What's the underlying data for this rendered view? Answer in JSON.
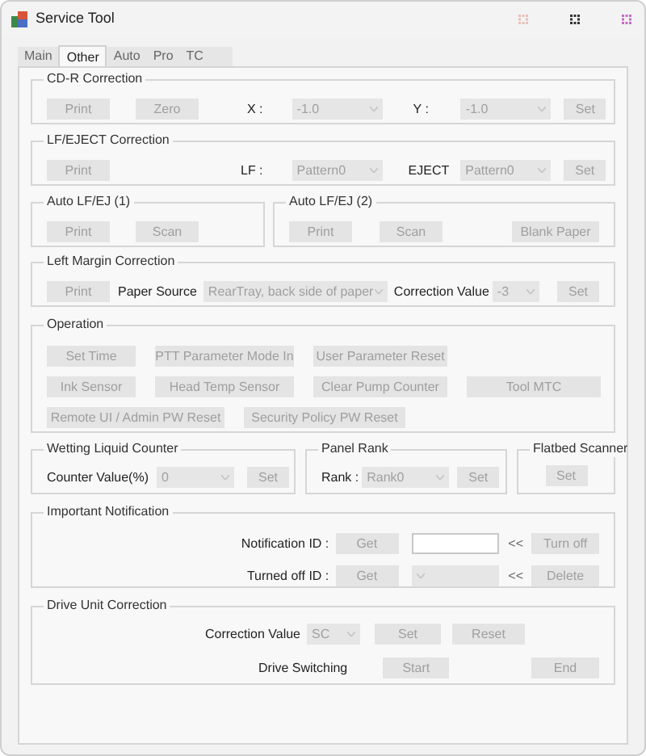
{
  "window": {
    "title": "Service Tool"
  },
  "tabs": [
    {
      "label": "Main",
      "selected": false
    },
    {
      "label": "Other",
      "selected": true
    },
    {
      "label": "Auto",
      "selected": false
    },
    {
      "label": "Pro",
      "selected": false
    },
    {
      "label": "TC",
      "selected": false
    }
  ],
  "cdr": {
    "title": "CD-R Correction",
    "print": {
      "label": "Print",
      "disabled": true
    },
    "zero": {
      "label": "Zero",
      "disabled": true
    },
    "x_label": "X :",
    "x_select": {
      "value": "-1.0",
      "disabled": true
    },
    "y_label": "Y :",
    "y_select": {
      "value": "-1.0",
      "disabled": true
    },
    "set": {
      "label": "Set",
      "disabled": true
    }
  },
  "lf_eject": {
    "title": "LF/EJECT Correction",
    "print": {
      "label": "Print",
      "disabled": true
    },
    "lf_label": "LF :",
    "lf_select": {
      "value": "Pattern0",
      "disabled": true
    },
    "eject_label": "EJECT",
    "eject_select": {
      "value": "Pattern0",
      "disabled": true
    },
    "set": {
      "label": "Set",
      "disabled": true
    }
  },
  "auto_lfej_1": {
    "title": "Auto LF/EJ (1)",
    "print": {
      "label": "Print",
      "disabled": true
    },
    "scan": {
      "label": "Scan",
      "disabled": true
    }
  },
  "auto_lfej_2": {
    "title": "Auto LF/EJ (2)",
    "print": {
      "label": "Print",
      "disabled": true
    },
    "scan": {
      "label": "Scan",
      "disabled": true
    },
    "blank_paper": {
      "label": "Blank Paper",
      "disabled": true
    }
  },
  "left_margin": {
    "title": "Left Margin Correction",
    "print": {
      "label": "Print",
      "disabled": true
    },
    "paper_source_label": "Paper Source",
    "paper_source_select": {
      "value": "RearTray, back side of paper",
      "disabled": true
    },
    "correction_value_label": "Correction Value",
    "correction_value_select": {
      "value": "-3",
      "disabled": true
    },
    "set": {
      "label": "Set",
      "disabled": true
    }
  },
  "operation": {
    "title": "Operation",
    "rows": [
      [
        {
          "label": "Set Time",
          "disabled": true
        },
        {
          "label": "PTT Parameter Mode In",
          "disabled": true
        },
        {
          "label": "User Parameter Reset",
          "disabled": true
        }
      ],
      [
        {
          "label": "Ink Sensor",
          "disabled": true
        },
        {
          "label": "Head Temp Sensor",
          "disabled": true
        },
        {
          "label": "Clear Pump Counter",
          "disabled": true
        },
        {
          "label": "Tool MTC",
          "disabled": true
        }
      ],
      [
        {
          "label": "Remote UI / Admin PW Reset",
          "disabled": true
        },
        {
          "label": "Security Policy PW Reset",
          "disabled": true
        }
      ]
    ]
  },
  "wetting": {
    "title": "Wetting Liquid Counter",
    "counter_label": "Counter Value(%)",
    "counter_select": {
      "value": "0",
      "disabled": true
    },
    "set": {
      "label": "Set",
      "disabled": true
    }
  },
  "panel_rank": {
    "title": "Panel Rank",
    "rank_label": "Rank :",
    "rank_select": {
      "value": "Rank0",
      "disabled": true
    },
    "set": {
      "label": "Set",
      "disabled": true
    }
  },
  "flatbed": {
    "title": "Flatbed Scanner",
    "set": {
      "label": "Set",
      "disabled": true
    }
  },
  "notification": {
    "title": "Important Notification",
    "notification_id_label": "Notification ID :",
    "get": {
      "label": "Get",
      "disabled": true
    },
    "turn_off_marker": "<<",
    "turn_off": {
      "label": "Turn off",
      "disabled": true
    },
    "turned_off_id_label": "Turned off ID :",
    "get_turned_off": {
      "label": "Get",
      "disabled": true
    },
    "turned_off_select": {
      "disabled": true
    },
    "delete_marker": "<<",
    "delete": {
      "label": "Delete",
      "disabled": true
    }
  },
  "drive_unit": {
    "title": "Drive Unit Correction",
    "correction_value_label": "Correction Value",
    "correction_value_select": {
      "value": "SC",
      "disabled": true
    },
    "set": {
      "label": "Set",
      "disabled": true
    },
    "reset": {
      "label": "Reset",
      "disabled": true
    },
    "drive_switching_label": "Drive Switching",
    "start": {
      "label": "Start",
      "disabled": true
    },
    "end": {
      "label": "End",
      "disabled": true
    }
  }
}
